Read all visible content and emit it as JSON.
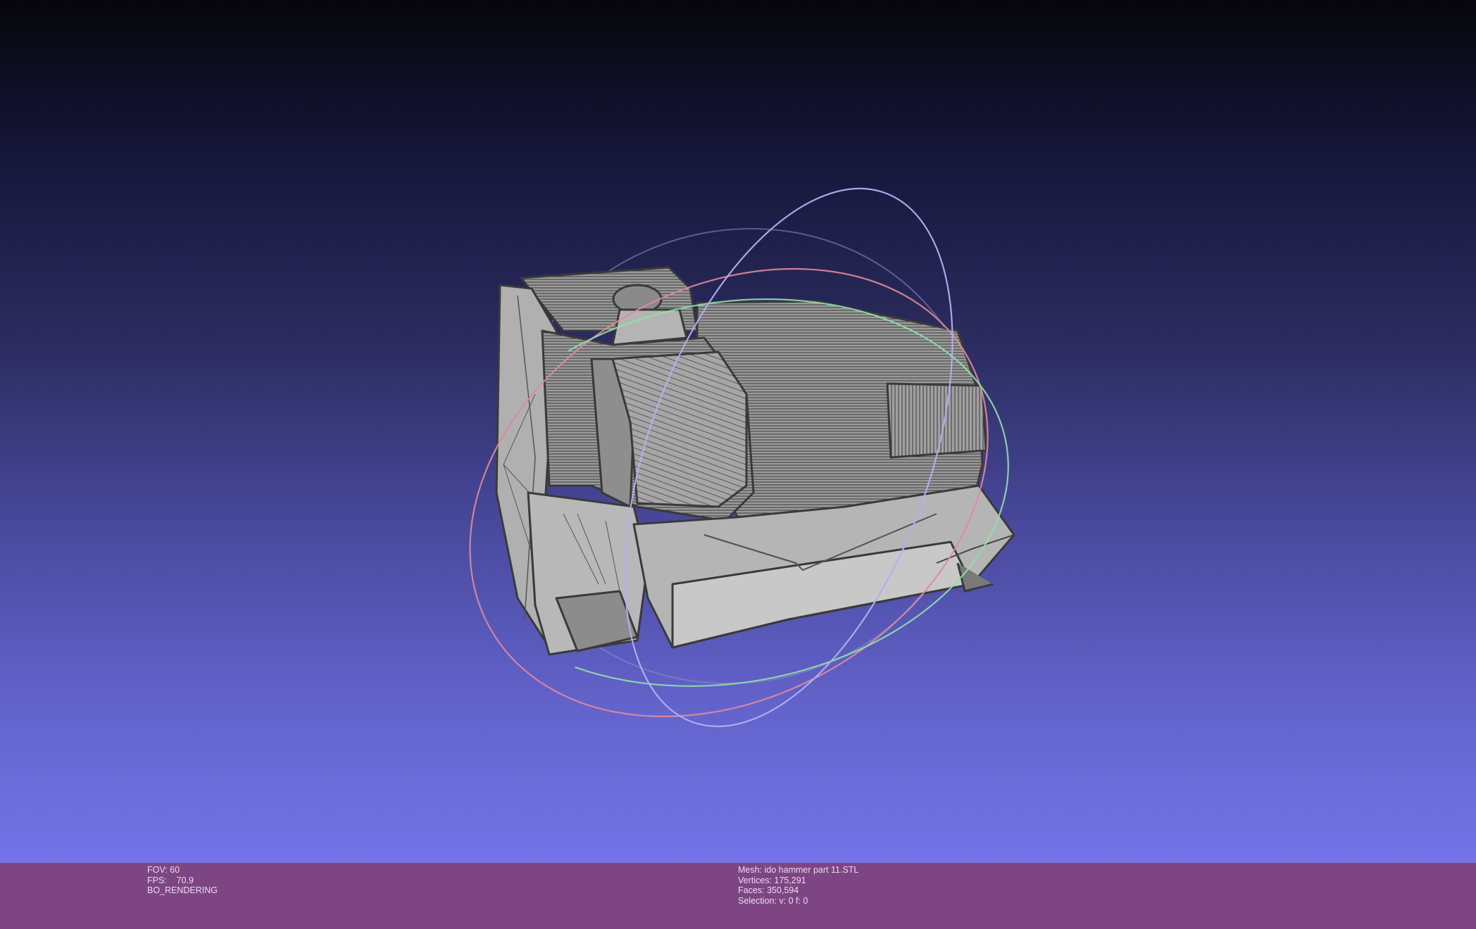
{
  "viewer": {
    "colors": {
      "background_top": "#06060a",
      "background_bottom": "#7474e8",
      "mesh_fill": "#a8a8a8",
      "mesh_wire": "#3c3c3c",
      "trackball_x": "#e08a9a",
      "trackball_y": "#8fe0a8",
      "trackball_z": "#b0b0f0",
      "infobar": "#7e4585"
    },
    "trackball": {
      "rings": [
        "x-axis",
        "y-axis",
        "z-axis"
      ]
    }
  },
  "info_left": {
    "fov": "FOV: 60",
    "fps": "FPS:    70.9",
    "mode": "BO_RENDERING"
  },
  "info_right": {
    "mesh": "Mesh: ido hammer part 11.STL",
    "vertices": "Vertices: 175,291",
    "faces": "Faces: 350,594",
    "selection": "Selection: v: 0 f: 0"
  }
}
